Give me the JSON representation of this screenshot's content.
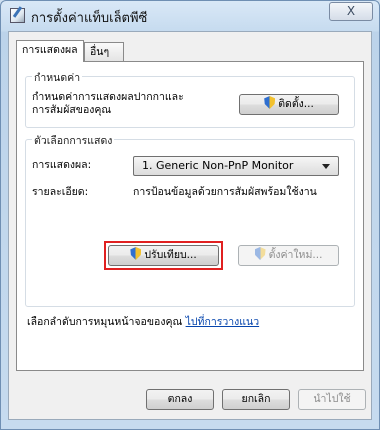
{
  "window": {
    "title": "การตั้งค่าแท็บเล็ตพีซี",
    "close_label": "X"
  },
  "tabs": [
    {
      "label": "การแสดงผล"
    },
    {
      "label": "อื่นๆ"
    }
  ],
  "configure": {
    "legend": "กำหนดค่า",
    "desc_line1": "กำหนดค่าการแสดงผลปากกาและ",
    "desc_line2": "การสัมผัสของคุณ",
    "setup_button": "ติดตั้ง..."
  },
  "display_options": {
    "legend": "ตัวเลือกการแสดง",
    "display_label": "การแสดงผล:",
    "display_value": "1. Generic Non-PnP Monitor",
    "details_label": "รายละเอียด:",
    "details_value": "การป้อนข้อมูลด้วยการสัมผัสพร้อมใช้งาน",
    "calibrate_button": "ปรับเทียบ...",
    "reset_button": "ตั้งค่าใหม่..."
  },
  "orientation": {
    "text": "เลือกลำดับการหมุนหน้าจอของคุณ",
    "link": "ไปที่การวางแนว"
  },
  "footer": {
    "ok": "ตกลง",
    "cancel": "ยกเลิก",
    "apply": "นำไปใช้"
  },
  "icons": {
    "title": "tablet-pen-icon",
    "shield": "uac-shield-icon",
    "dropdown": "chevron-down-icon"
  },
  "colors": {
    "highlight": "#e02020",
    "link": "#0645ad"
  }
}
